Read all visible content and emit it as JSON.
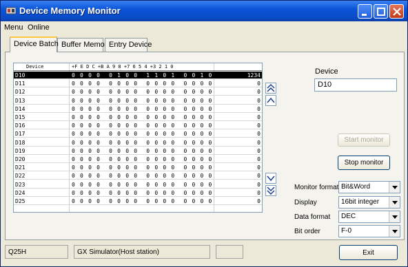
{
  "window": {
    "title": "Device Memory Monitor",
    "title_bar_color": "#0a4bc6"
  },
  "menu": {
    "items": [
      "Menu",
      "Online"
    ]
  },
  "tabs": [
    "Device Batch",
    "Buffer Memory",
    "Entry Device"
  ],
  "grid": {
    "header_device": "Device",
    "header_bits": "+F E D C +B A 9 8 +7 6 5 4 +3 2 1 0",
    "rows": [
      {
        "device": "D10",
        "bits": "0 0 0 0  0 1 0 0  1 1 0 1  0 0 1 0",
        "value": "1234"
      },
      {
        "device": "D11",
        "bits": "0 0 0 0  0 0 0 0  0 0 0 0  0 0 0 0",
        "value": "0"
      },
      {
        "device": "D12",
        "bits": "0 0 0 0  0 0 0 0  0 0 0 0  0 0 0 0",
        "value": "0"
      },
      {
        "device": "D13",
        "bits": "0 0 0 0  0 0 0 0  0 0 0 0  0 0 0 0",
        "value": "0"
      },
      {
        "device": "D14",
        "bits": "0 0 0 0  0 0 0 0  0 0 0 0  0 0 0 0",
        "value": "0"
      },
      {
        "device": "D15",
        "bits": "0 0 0 0  0 0 0 0  0 0 0 0  0 0 0 0",
        "value": "0"
      },
      {
        "device": "D16",
        "bits": "0 0 0 0  0 0 0 0  0 0 0 0  0 0 0 0",
        "value": "0"
      },
      {
        "device": "D17",
        "bits": "0 0 0 0  0 0 0 0  0 0 0 0  0 0 0 0",
        "value": "0"
      },
      {
        "device": "D18",
        "bits": "0 0 0 0  0 0 0 0  0 0 0 0  0 0 0 0",
        "value": "0"
      },
      {
        "device": "D19",
        "bits": "0 0 0 0  0 0 0 0  0 0 0 0  0 0 0 0",
        "value": "0"
      },
      {
        "device": "D20",
        "bits": "0 0 0 0  0 0 0 0  0 0 0 0  0 0 0 0",
        "value": "0"
      },
      {
        "device": "D21",
        "bits": "0 0 0 0  0 0 0 0  0 0 0 0  0 0 0 0",
        "value": "0"
      },
      {
        "device": "D22",
        "bits": "0 0 0 0  0 0 0 0  0 0 0 0  0 0 0 0",
        "value": "0"
      },
      {
        "device": "D23",
        "bits": "0 0 0 0  0 0 0 0  0 0 0 0  0 0 0 0",
        "value": "0"
      },
      {
        "device": "D24",
        "bits": "0 0 0 0  0 0 0 0  0 0 0 0  0 0 0 0",
        "value": "0"
      },
      {
        "device": "D25",
        "bits": "0 0 0 0  0 0 0 0  0 0 0 0  0 0 0 0",
        "value": "0"
      }
    ]
  },
  "device_field": {
    "label": "Device",
    "value": "D10"
  },
  "buttons": {
    "start_monitor": "Start monitor",
    "stop_monitor": "Stop monitor",
    "exit": "Exit"
  },
  "options": {
    "monitor_format": {
      "label": "Monitor format",
      "value": "Bit&Word"
    },
    "display": {
      "label": "Display",
      "value": "16bit integer"
    },
    "data_format": {
      "label": "Data format",
      "value": "DEC"
    },
    "bit_order": {
      "label": "Bit order",
      "value": "F-0"
    }
  },
  "status": {
    "cpu": "Q25H",
    "connection": "GX Simulator(Host station)",
    "extra": ""
  },
  "icons": {
    "scroll_page_up": "double-chevron-up-icon",
    "scroll_up": "chevron-up-icon",
    "scroll_down": "chevron-down-icon",
    "scroll_page_down": "double-chevron-down-icon",
    "dropdown": "triangle-down-icon"
  }
}
